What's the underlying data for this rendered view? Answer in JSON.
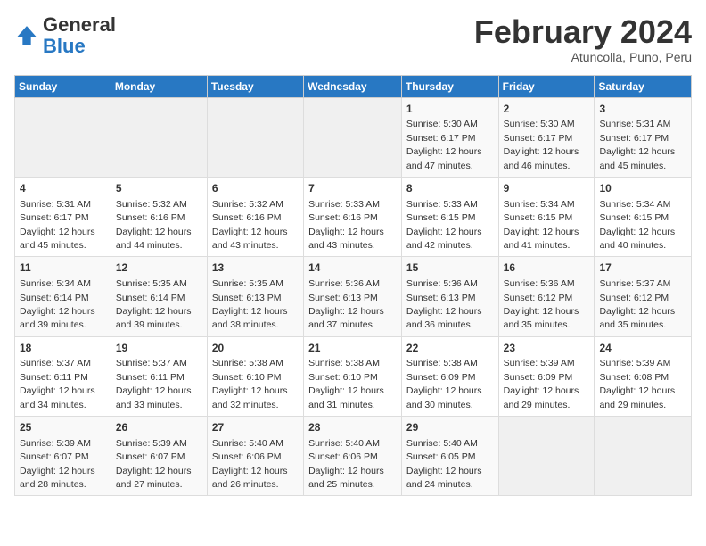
{
  "logo": {
    "general": "General",
    "blue": "Blue"
  },
  "title": "February 2024",
  "subtitle": "Atuncolla, Puno, Peru",
  "days_of_week": [
    "Sunday",
    "Monday",
    "Tuesday",
    "Wednesday",
    "Thursday",
    "Friday",
    "Saturday"
  ],
  "weeks": [
    [
      {
        "day": "",
        "info": ""
      },
      {
        "day": "",
        "info": ""
      },
      {
        "day": "",
        "info": ""
      },
      {
        "day": "",
        "info": ""
      },
      {
        "day": "1",
        "info": "Sunrise: 5:30 AM\nSunset: 6:17 PM\nDaylight: 12 hours and 47 minutes."
      },
      {
        "day": "2",
        "info": "Sunrise: 5:30 AM\nSunset: 6:17 PM\nDaylight: 12 hours and 46 minutes."
      },
      {
        "day": "3",
        "info": "Sunrise: 5:31 AM\nSunset: 6:17 PM\nDaylight: 12 hours and 45 minutes."
      }
    ],
    [
      {
        "day": "4",
        "info": "Sunrise: 5:31 AM\nSunset: 6:17 PM\nDaylight: 12 hours and 45 minutes."
      },
      {
        "day": "5",
        "info": "Sunrise: 5:32 AM\nSunset: 6:16 PM\nDaylight: 12 hours and 44 minutes."
      },
      {
        "day": "6",
        "info": "Sunrise: 5:32 AM\nSunset: 6:16 PM\nDaylight: 12 hours and 43 minutes."
      },
      {
        "day": "7",
        "info": "Sunrise: 5:33 AM\nSunset: 6:16 PM\nDaylight: 12 hours and 43 minutes."
      },
      {
        "day": "8",
        "info": "Sunrise: 5:33 AM\nSunset: 6:15 PM\nDaylight: 12 hours and 42 minutes."
      },
      {
        "day": "9",
        "info": "Sunrise: 5:34 AM\nSunset: 6:15 PM\nDaylight: 12 hours and 41 minutes."
      },
      {
        "day": "10",
        "info": "Sunrise: 5:34 AM\nSunset: 6:15 PM\nDaylight: 12 hours and 40 minutes."
      }
    ],
    [
      {
        "day": "11",
        "info": "Sunrise: 5:34 AM\nSunset: 6:14 PM\nDaylight: 12 hours and 39 minutes."
      },
      {
        "day": "12",
        "info": "Sunrise: 5:35 AM\nSunset: 6:14 PM\nDaylight: 12 hours and 39 minutes."
      },
      {
        "day": "13",
        "info": "Sunrise: 5:35 AM\nSunset: 6:13 PM\nDaylight: 12 hours and 38 minutes."
      },
      {
        "day": "14",
        "info": "Sunrise: 5:36 AM\nSunset: 6:13 PM\nDaylight: 12 hours and 37 minutes."
      },
      {
        "day": "15",
        "info": "Sunrise: 5:36 AM\nSunset: 6:13 PM\nDaylight: 12 hours and 36 minutes."
      },
      {
        "day": "16",
        "info": "Sunrise: 5:36 AM\nSunset: 6:12 PM\nDaylight: 12 hours and 35 minutes."
      },
      {
        "day": "17",
        "info": "Sunrise: 5:37 AM\nSunset: 6:12 PM\nDaylight: 12 hours and 35 minutes."
      }
    ],
    [
      {
        "day": "18",
        "info": "Sunrise: 5:37 AM\nSunset: 6:11 PM\nDaylight: 12 hours and 34 minutes."
      },
      {
        "day": "19",
        "info": "Sunrise: 5:37 AM\nSunset: 6:11 PM\nDaylight: 12 hours and 33 minutes."
      },
      {
        "day": "20",
        "info": "Sunrise: 5:38 AM\nSunset: 6:10 PM\nDaylight: 12 hours and 32 minutes."
      },
      {
        "day": "21",
        "info": "Sunrise: 5:38 AM\nSunset: 6:10 PM\nDaylight: 12 hours and 31 minutes."
      },
      {
        "day": "22",
        "info": "Sunrise: 5:38 AM\nSunset: 6:09 PM\nDaylight: 12 hours and 30 minutes."
      },
      {
        "day": "23",
        "info": "Sunrise: 5:39 AM\nSunset: 6:09 PM\nDaylight: 12 hours and 29 minutes."
      },
      {
        "day": "24",
        "info": "Sunrise: 5:39 AM\nSunset: 6:08 PM\nDaylight: 12 hours and 29 minutes."
      }
    ],
    [
      {
        "day": "25",
        "info": "Sunrise: 5:39 AM\nSunset: 6:07 PM\nDaylight: 12 hours and 28 minutes."
      },
      {
        "day": "26",
        "info": "Sunrise: 5:39 AM\nSunset: 6:07 PM\nDaylight: 12 hours and 27 minutes."
      },
      {
        "day": "27",
        "info": "Sunrise: 5:40 AM\nSunset: 6:06 PM\nDaylight: 12 hours and 26 minutes."
      },
      {
        "day": "28",
        "info": "Sunrise: 5:40 AM\nSunset: 6:06 PM\nDaylight: 12 hours and 25 minutes."
      },
      {
        "day": "29",
        "info": "Sunrise: 5:40 AM\nSunset: 6:05 PM\nDaylight: 12 hours and 24 minutes."
      },
      {
        "day": "",
        "info": ""
      },
      {
        "day": "",
        "info": ""
      }
    ]
  ]
}
